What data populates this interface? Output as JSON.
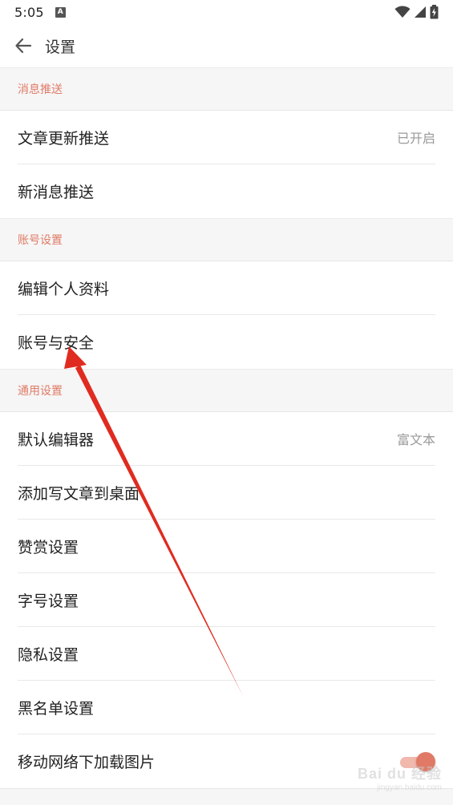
{
  "status_bar": {
    "time": "5:05",
    "notification_badge": "A"
  },
  "app_bar": {
    "title": "设置"
  },
  "sections": [
    {
      "header": "消息推送",
      "items": [
        {
          "label": "文章更新推送",
          "value": "已开启"
        },
        {
          "label": "新消息推送",
          "value": ""
        }
      ]
    },
    {
      "header": "账号设置",
      "items": [
        {
          "label": "编辑个人资料",
          "value": ""
        },
        {
          "label": "账号与安全",
          "value": ""
        }
      ]
    },
    {
      "header": "通用设置",
      "items": [
        {
          "label": "默认编辑器",
          "value": "富文本"
        },
        {
          "label": "添加写文章到桌面",
          "value": ""
        },
        {
          "label": "赞赏设置",
          "value": ""
        },
        {
          "label": "字号设置",
          "value": ""
        },
        {
          "label": "隐私设置",
          "value": ""
        },
        {
          "label": "黑名单设置",
          "value": ""
        },
        {
          "label": "移动网络下加载图片",
          "value": "",
          "toggle": true
        }
      ]
    }
  ],
  "watermark": {
    "main": "Bai du 经验",
    "sub": "jingyan.baidu.com"
  },
  "colors": {
    "accent": "#e07a67",
    "toggle_track": "#f1b8ad",
    "annotation_arrow": "#e02b20"
  },
  "icons": {
    "back": "arrow-left-icon",
    "wifi": "wifi-icon",
    "signal": "signal-icon",
    "battery": "battery-charging-icon"
  }
}
